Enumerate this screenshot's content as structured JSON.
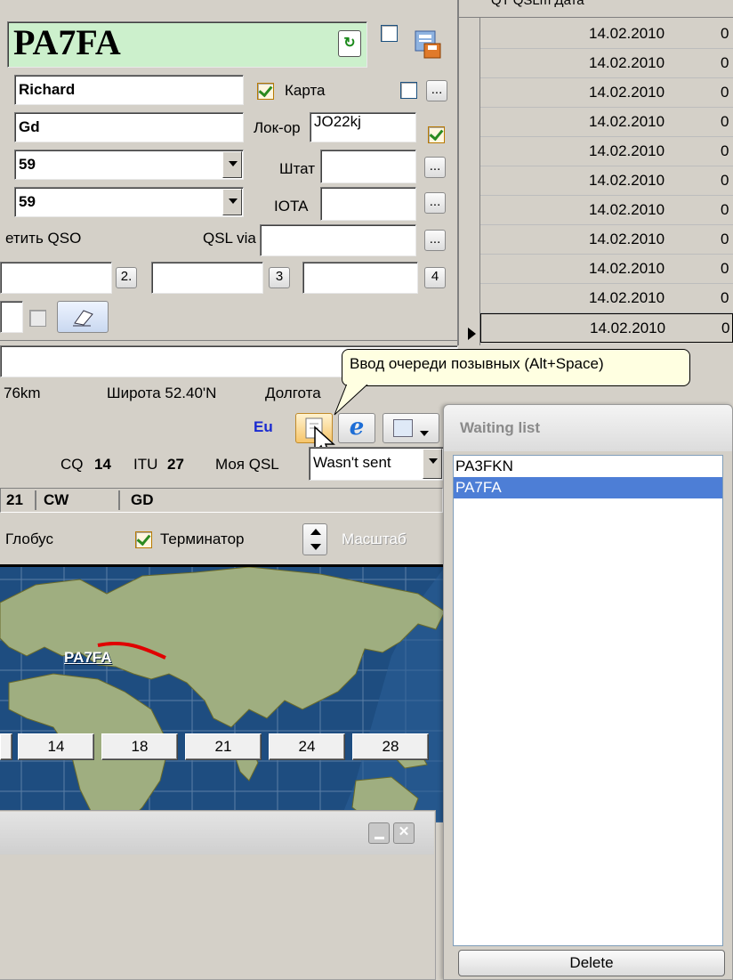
{
  "entry": {
    "callsign": "PA7FA",
    "name": "Richard",
    "greeting": "Gd",
    "rst_sent": "59",
    "rst_rcvd": "59",
    "card_label": "Карта",
    "locator_label": "Лок-ор",
    "locator_value": "JO22kj",
    "state_label": "Штат",
    "state_value": "",
    "iota_label": "IOTA",
    "iota_value": "",
    "note_label": "етить QSO",
    "qslvia_label": "QSL via",
    "qslvia_value": "",
    "ellipsis": "...",
    "fkey2": "2.",
    "fkey3": "3",
    "fkey4": "4"
  },
  "log_grid": {
    "header_text": "QT QSLm Дата",
    "rows": [
      {
        "date": "14.02.2010",
        "col2": "0"
      },
      {
        "date": "14.02.2010",
        "col2": "0"
      },
      {
        "date": "14.02.2010",
        "col2": "0"
      },
      {
        "date": "14.02.2010",
        "col2": "0"
      },
      {
        "date": "14.02.2010",
        "col2": "0"
      },
      {
        "date": "14.02.2010",
        "col2": "0"
      },
      {
        "date": "14.02.2010",
        "col2": "0"
      },
      {
        "date": "14.02.2010",
        "col2": "0"
      },
      {
        "date": "14.02.2010",
        "col2": "0"
      },
      {
        "date": "14.02.2010",
        "col2": "0"
      },
      {
        "date": "14.02.2010",
        "col2": "0"
      }
    ]
  },
  "info": {
    "distance": "76km",
    "latitude": "Широта 52.40'N",
    "longitude_label": "Долгота",
    "continent": "Eu",
    "cq_label": "CQ",
    "cq_value": "14",
    "itu_label": "ITU",
    "itu_value": "27",
    "my_qsl_label": "Моя QSL",
    "my_qsl_value": "Wasn't sent",
    "status_time": "21",
    "status_mode": "CW",
    "status_greet": "GD"
  },
  "tooltip": {
    "text": "Ввод очереди позывных (Alt+Space)"
  },
  "map": {
    "globe_label": "Глобус",
    "terminator_label": "Терминатор",
    "scale_label": "Масштаб",
    "callsign_label": "PA7FA"
  },
  "bands_window": {
    "buttons": [
      "14",
      "18",
      "21",
      "24",
      "28"
    ]
  },
  "waiting_list": {
    "title": "Waiting list",
    "items": [
      "PA3FKN",
      "PA7FA"
    ],
    "selected_index": 1,
    "delete_label": "Delete"
  },
  "colors": {
    "selection": "#4d7ed6",
    "callsign_bg": "#ccf0cc",
    "continent": "#1a2ad1",
    "tooltip_bg": "#ffffe1",
    "map_ocean": "#1e4d80",
    "map_land": "#9fae80",
    "path_line": "#e00000"
  }
}
